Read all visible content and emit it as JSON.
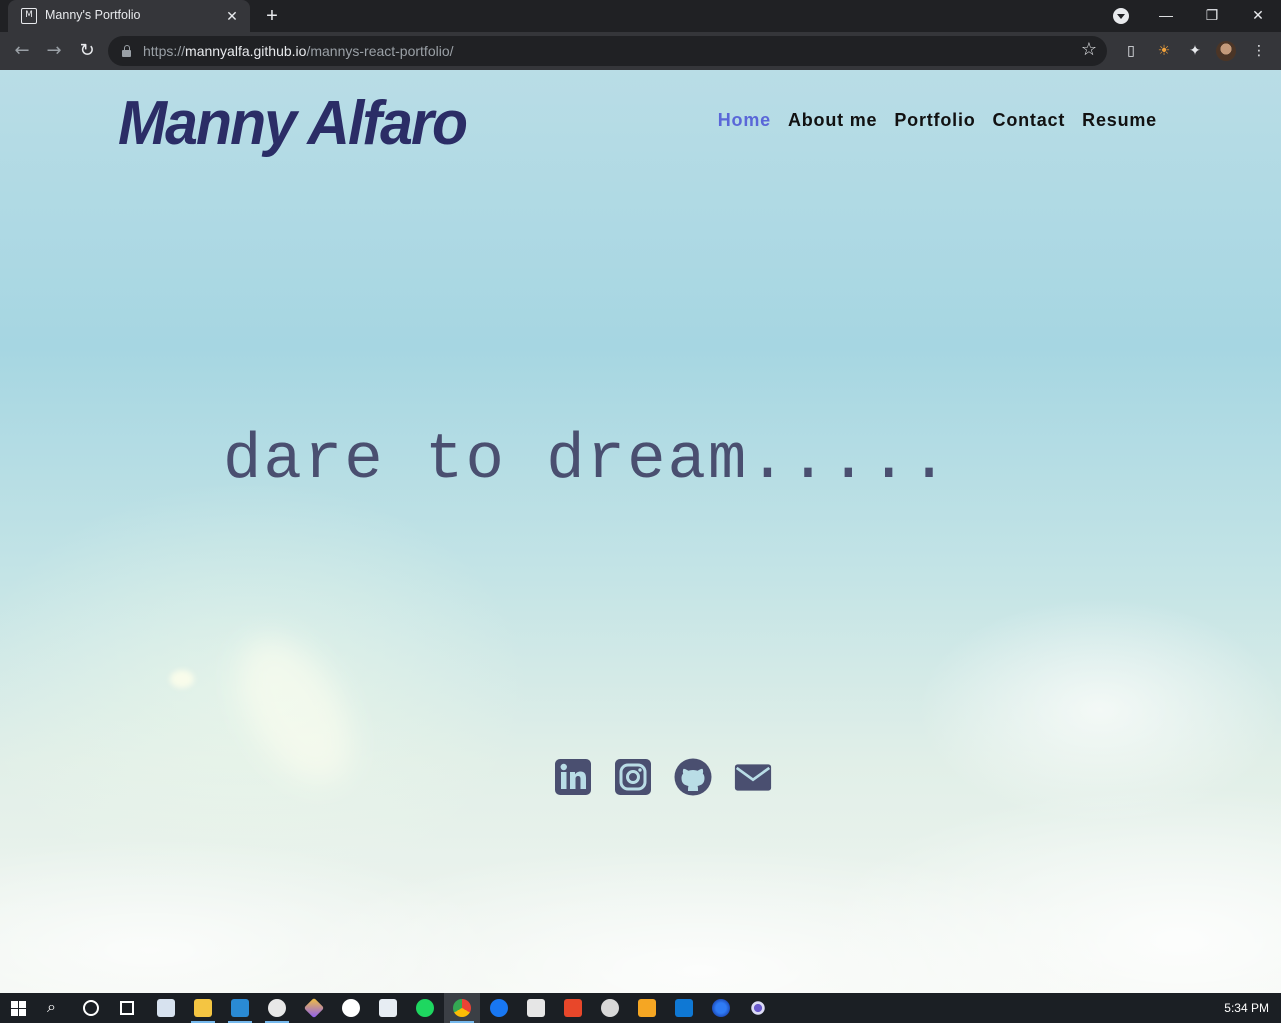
{
  "browser": {
    "tab_title": "Manny's Portfolio",
    "url_scheme": "https://",
    "url_host": "mannyalfa.github.io",
    "url_path": "/mannys-react-portfolio/"
  },
  "site": {
    "brand": "Manny Alfaro",
    "nav": [
      {
        "label": "Home",
        "active": true
      },
      {
        "label": "About me",
        "active": false
      },
      {
        "label": "Portfolio",
        "active": false
      },
      {
        "label": "Contact",
        "active": false
      },
      {
        "label": "Resume",
        "active": false
      }
    ],
    "tagline": "dare to dream.....",
    "socials": [
      "linkedin-icon",
      "instagram-icon",
      "github-icon",
      "mail-icon"
    ],
    "colors": {
      "brand": "#2b2d66",
      "nav_active": "#5a67d8",
      "icon": "#4a4f70"
    }
  },
  "taskbar": {
    "apps": [
      "windows-start-icon",
      "search-icon",
      "cortana-icon",
      "task-view-icon",
      "notes-app-icon",
      "file-explorer-icon",
      "vscode-icon",
      "slack-icon",
      "git-kraken-icon",
      "github-desktop-icon",
      "kite-icon",
      "spotify-icon",
      "chrome-icon",
      "facebook-icon",
      "store-icon",
      "office-icon",
      "paint-icon",
      "video-editor-icon",
      "outlook-icon",
      "firefox-icon",
      "browser-icon"
    ],
    "clock": "5:34 PM"
  }
}
